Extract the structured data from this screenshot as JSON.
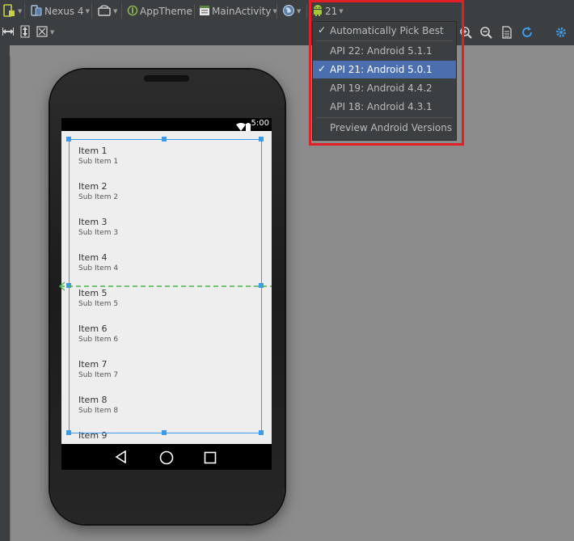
{
  "toolbar": {
    "device_label": "Nexus 4",
    "theme_label": "AppTheme",
    "activity_label": "MainActivity",
    "api_label": "21"
  },
  "phone": {
    "status_time": "5:00"
  },
  "list": {
    "items": [
      {
        "title": "Item 1",
        "sub": "Sub Item 1"
      },
      {
        "title": "Item 2",
        "sub": "Sub Item 2"
      },
      {
        "title": "Item 3",
        "sub": "Sub Item 3"
      },
      {
        "title": "Item 4",
        "sub": "Sub Item 4"
      },
      {
        "title": "Item 5",
        "sub": "Sub Item 5"
      },
      {
        "title": "Item 6",
        "sub": "Sub Item 6"
      },
      {
        "title": "Item 7",
        "sub": "Sub Item 7"
      },
      {
        "title": "Item 8",
        "sub": "Sub Item 8"
      },
      {
        "title": "Item 9",
        "sub": ""
      }
    ]
  },
  "dropdown": {
    "items": [
      {
        "label": "Automatically Pick Best",
        "checked": true,
        "selected": false
      },
      {
        "label": "API 22: Android 5.1.1",
        "checked": false,
        "selected": false
      },
      {
        "label": "API 21: Android 5.0.1",
        "checked": true,
        "selected": true
      },
      {
        "label": "API 19: Android 4.4.2",
        "checked": false,
        "selected": false
      },
      {
        "label": "API 18: Android 4.3.1",
        "checked": false,
        "selected": false
      },
      {
        "label": "Preview Android Versions",
        "checked": false,
        "selected": false
      }
    ]
  },
  "colors": {
    "selection": "#3d9be9",
    "highlight": "#e01f26",
    "menu_selected": "#4b6eaf",
    "android_green": "#a4c639"
  }
}
